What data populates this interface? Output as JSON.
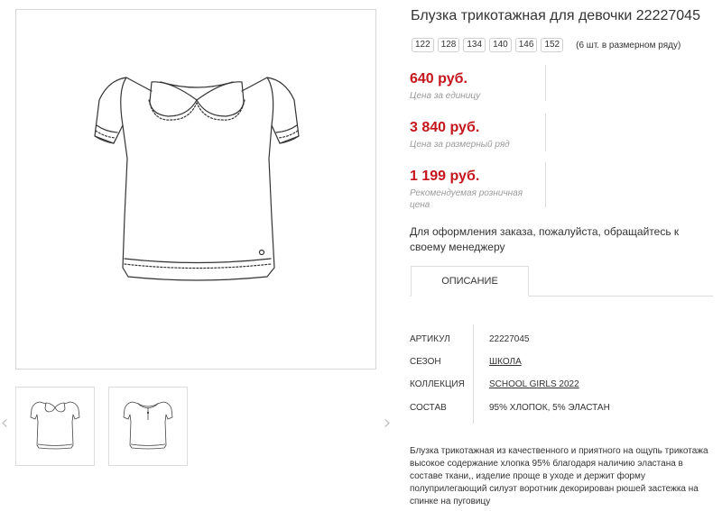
{
  "product": {
    "title": "Блузка трикотажная для девочки 22227045",
    "sizes": [
      "122",
      "128",
      "134",
      "140",
      "146",
      "152"
    ],
    "sizes_note": "(6 шт. в размерном ряду)"
  },
  "prices": [
    {
      "value": "640 руб.",
      "label": "Цена за единицу"
    },
    {
      "value": "3 840 руб.",
      "label": "Цена за размерный ряд"
    },
    {
      "value": "1 199 руб.",
      "label": "Рекомендуемая розничная цена"
    }
  ],
  "contact_note": "Для оформления заказа, пожалуйста, обращайтесь к своему менеджеру",
  "tabs": [
    {
      "label": "ОПИСАНИЕ"
    }
  ],
  "attributes": [
    {
      "key": "АРТИКУЛ",
      "value": "22227045",
      "link": false
    },
    {
      "key": "СЕЗОН",
      "value": "ШКОЛА",
      "link": true
    },
    {
      "key": "КОЛЛЕКЦИЯ",
      "value": "SCHOOL GIRLS 2022",
      "link": true
    },
    {
      "key": "СОСТАВ",
      "value": "95% ХЛОПОК, 5% ЭЛАСТАН",
      "link": false
    }
  ],
  "description": "Блузка трикотажная из качественного и приятного на ощупь трикотажа высокое содержание хлопка 95% благодаря наличию эластана в составе ткани,, изделие проще в уходе и держит форму полуприлегающий силуэт воротник декорирован рюшей застежка на спинке на пуговицу",
  "icons": {
    "prev": "chevron-left-icon",
    "next": "chevron-right-icon"
  },
  "colors": {
    "price": "#c4161c",
    "border": "#dcdcdc",
    "label": "#9a9a9a"
  }
}
